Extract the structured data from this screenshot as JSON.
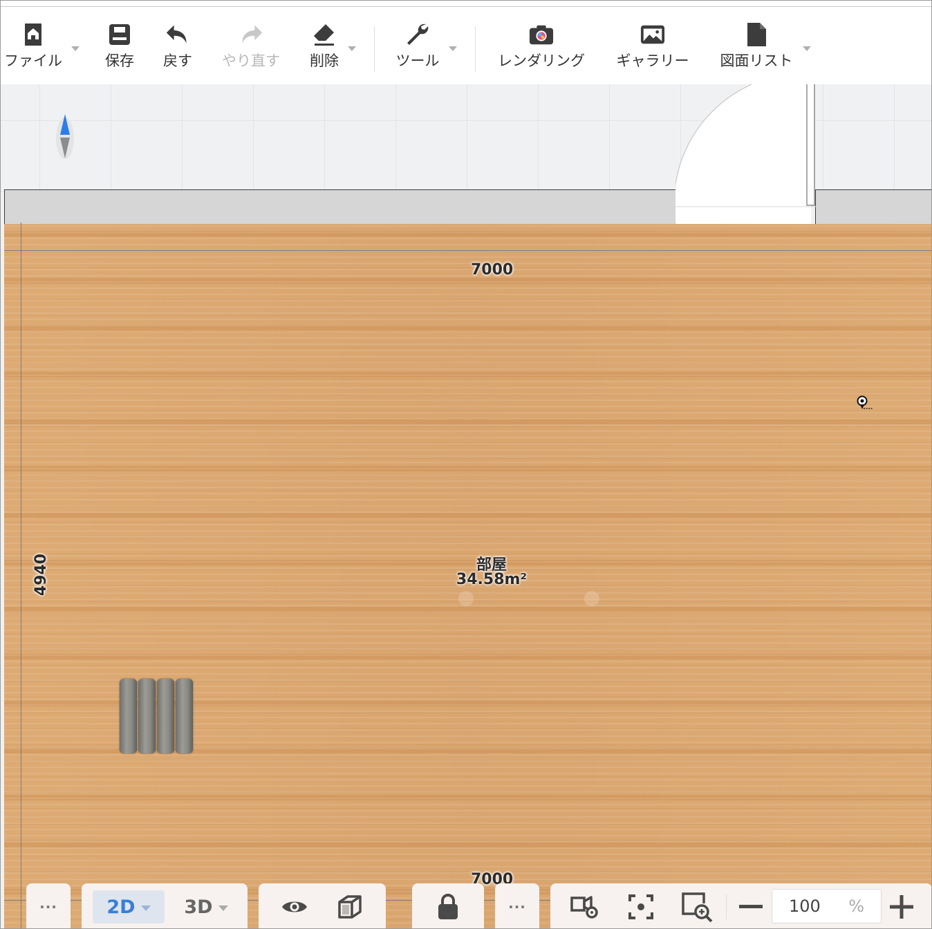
{
  "toolbar": {
    "file_label": "ファイル",
    "save_label": "保存",
    "undo_label": "戻す",
    "redo_label": "やり直す",
    "delete_label": "削除",
    "tools_label": "ツール",
    "render_label": "レンダリング",
    "gallery_label": "ギャラリー",
    "drawing_list_label": "図面リスト"
  },
  "plan": {
    "top_dimension": "7000",
    "bottom_dimension": "7000",
    "left_dimension": "4940",
    "room_name": "部屋",
    "room_area": "34.58m²"
  },
  "bottombar": {
    "more_left": "···",
    "view_2d": "2D",
    "view_3d": "3D",
    "more_mid": "···",
    "zoom_value": "100",
    "zoom_unit": "%"
  },
  "colors": {
    "accent": "#3a7fd5",
    "floor": "#daa772",
    "wall": "#d6d6d6",
    "compass_north": "#2b7de9",
    "compass_south": "#8c8c8c"
  }
}
